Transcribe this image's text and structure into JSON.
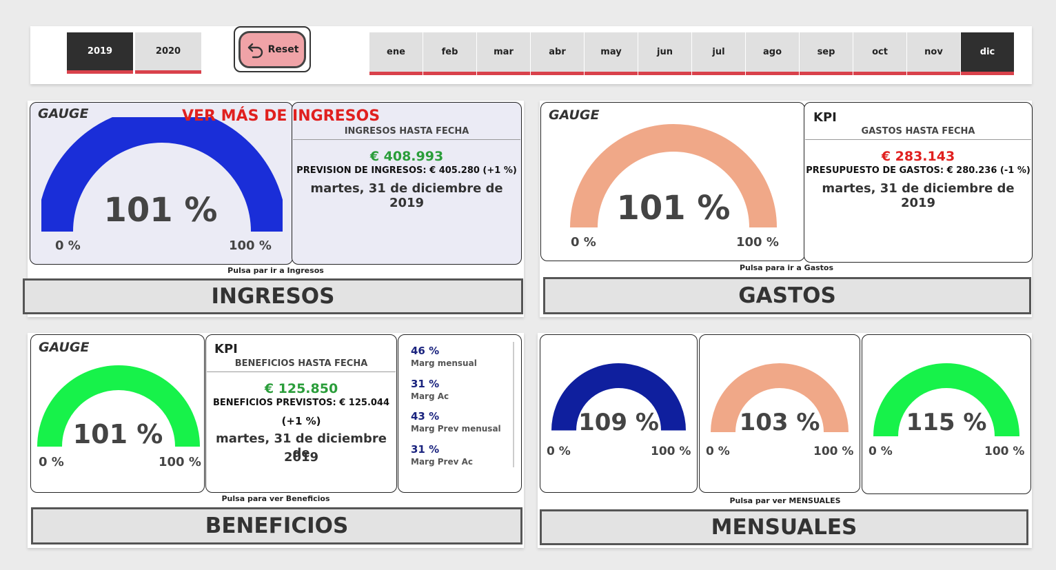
{
  "years": [
    {
      "label": "2019",
      "selected": true
    },
    {
      "label": "2020",
      "selected": false
    }
  ],
  "reset": {
    "label": "Reset",
    "icon": "undo-arrow-icon"
  },
  "months": [
    {
      "label": "ene",
      "selected": false
    },
    {
      "label": "feb",
      "selected": false
    },
    {
      "label": "mar",
      "selected": false
    },
    {
      "label": "abr",
      "selected": false
    },
    {
      "label": "may",
      "selected": false
    },
    {
      "label": "jun",
      "selected": false
    },
    {
      "label": "jul",
      "selected": false
    },
    {
      "label": "ago",
      "selected": false
    },
    {
      "label": "sep",
      "selected": false
    },
    {
      "label": "oct",
      "selected": false
    },
    {
      "label": "nov",
      "selected": false
    },
    {
      "label": "dic",
      "selected": true
    }
  ],
  "ingresos": {
    "gauge_title": "GAUGE",
    "link_title": "VER MÁS DE INGRESOS",
    "gauge_pct": "101 %",
    "gauge_fraction": 1.0,
    "gauge_min": "0 %",
    "gauge_max": "100 %",
    "gauge_color": "#1a2ed8",
    "kpi_sub": "INGRESOS HASTA FECHA",
    "kpi_value": "€ 408.993",
    "kpi_value_color": "#2a9d3a",
    "kpi_prev": "PREVISION DE INGRESOS: € 405.280 (+1 %)",
    "kpi_date": "martes, 31 de diciembre de 2019",
    "hint": "Pulsa par ir a Ingresos",
    "button": "INGRESOS"
  },
  "gastos": {
    "gauge_title": "GAUGE",
    "gauge_pct": "101 %",
    "gauge_fraction": 1.0,
    "gauge_min": "0 %",
    "gauge_max": "100 %",
    "gauge_color": "#f0a888",
    "kpi_title": "KPI",
    "kpi_sub": "GASTOS HASTA FECHA",
    "kpi_value": "€ 283.143",
    "kpi_value_color": "#e0201f",
    "kpi_prev": "PRESUPUESTO DE GASTOS: € 280.236 (-1 %)",
    "kpi_date": "martes, 31 de diciembre de 2019",
    "hint": "Pulsa para ir a Gastos",
    "button": "GASTOS"
  },
  "beneficios": {
    "gauge_title": "GAUGE",
    "gauge_pct": "101 %",
    "gauge_fraction": 1.0,
    "gauge_min": "0 %",
    "gauge_max": "100 %",
    "gauge_color": "#17f24a",
    "kpi_title": "KPI",
    "kpi_sub": "BENEFICIOS HASTA FECHA",
    "kpi_value": "€ 125.850",
    "kpi_value_color": "#2a9d3a",
    "kpi_prev": "BENEFICIOS PREVISTOS: € 125.044",
    "kpi_prev2": "(+1 %)",
    "kpi_date1": "martes, 31 de diciembre de",
    "kpi_date2": "2019",
    "margins": [
      {
        "value": "46 %",
        "label": "Marg mensual"
      },
      {
        "value": "31 %",
        "label": "Marg Ac"
      },
      {
        "value": "43 %",
        "label": "Marg Prev menusal"
      },
      {
        "value": "31 %",
        "label": "Marg Prev Ac"
      }
    ],
    "hint": "Pulsa para ver Beneficios",
    "button": "BENEFICIOS"
  },
  "mensuales": {
    "gauges": [
      {
        "pct": "109 %",
        "fraction": 1.0,
        "min": "0 %",
        "max": "100 %",
        "color": "#0f1f9e"
      },
      {
        "pct": "103 %",
        "fraction": 1.0,
        "min": "0 %",
        "max": "100 %",
        "color": "#f0a888"
      },
      {
        "pct": "115 %",
        "fraction": 1.0,
        "min": "0 %",
        "max": "100 %",
        "color": "#17f24a"
      }
    ],
    "hint": "Pulsa par ver MENSUALES",
    "button": "MENSUALES"
  }
}
